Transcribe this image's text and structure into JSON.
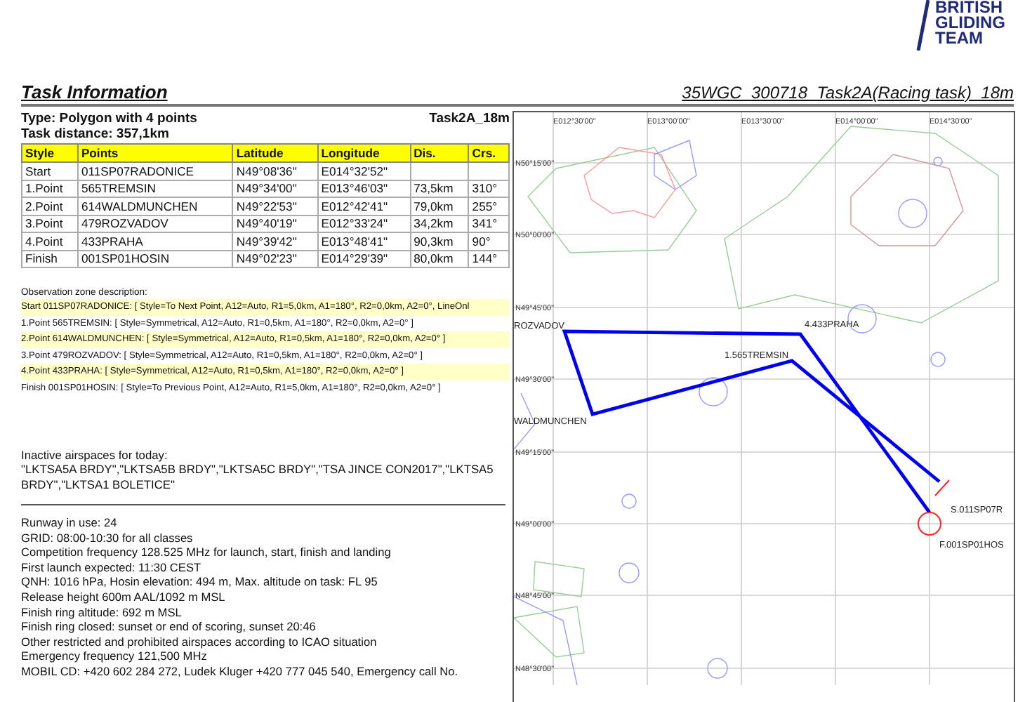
{
  "logo": {
    "lines": [
      "BRITISH",
      "GLIDING",
      "TEAM"
    ]
  },
  "header": {
    "title": "Task Information",
    "task_name": "35WGC_300718_Task2A(Racing task)_18m"
  },
  "task": {
    "type": "Type: Polygon with 4 points",
    "class_name": "Task2A_18m",
    "distance": "Task distance: 357,1km"
  },
  "table": {
    "columns": [
      "Style",
      "Points",
      "Latitude",
      "Longitude",
      "Dis.",
      "Crs."
    ],
    "rows": [
      [
        "Start",
        "011SP07RADONICE",
        "N49°08'36\"",
        "E014°32'52\"",
        "",
        ""
      ],
      [
        "1.Point",
        "565TREMSIN",
        "N49°34'00\"",
        "E013°46'03\"",
        "73,5km",
        "310°"
      ],
      [
        "2.Point",
        "614WALDMUNCHEN",
        "N49°22'53\"",
        "E012°42'41\"",
        "79,0km",
        "255°"
      ],
      [
        "3.Point",
        "479ROZVADOV",
        "N49°40'19\"",
        "E012°33'24\"",
        "34,2km",
        "341°"
      ],
      [
        "4.Point",
        "433PRAHA",
        "N49°39'42\"",
        "E013°48'41\"",
        "90,3km",
        "90°"
      ],
      [
        "Finish",
        "001SP01HOSIN",
        "N49°02'23\"",
        "E014°29'39\"",
        "80,0km",
        "144°"
      ]
    ]
  },
  "observation_zones": {
    "heading": "Observation zone description:",
    "items": [
      {
        "text": "Start 011SP07RADONICE: [ Style=To Next Point, A12=Auto, R1=5,0km, A1=180°, R2=0,0km, A2=0°, LineOnl",
        "highlighted": true
      },
      {
        "text": "1.Point 565TREMSIN: [ Style=Symmetrical, A12=Auto, R1=0,5km, A1=180°, R2=0,0km, A2=0° ]",
        "highlighted": false
      },
      {
        "text": "2.Point 614WALDMUNCHEN: [ Style=Symmetrical, A12=Auto, R1=0,5km, A1=180°, R2=0,0km, A2=0° ]",
        "highlighted": true
      },
      {
        "text": "3.Point 479ROZVADOV: [ Style=Symmetrical, A12=Auto, R1=0,5km, A1=180°, R2=0,0km, A2=0° ]",
        "highlighted": false
      },
      {
        "text": "4.Point 433PRAHA: [ Style=Symmetrical, A12=Auto, R1=0,5km, A1=180°, R2=0,0km, A2=0° ]",
        "highlighted": true
      },
      {
        "text": "Finish 001SP01HOSIN: [ Style=To Previous Point, A12=Auto, R1=5,0km, A1=180°, R2=0,0km, A2=0° ]",
        "highlighted": false
      }
    ]
  },
  "inactive_airspaces": {
    "heading": "Inactive airspaces for today:",
    "text": "\"LKTSA5A BRDY\",\"LKTSA5B BRDY\",\"LKTSA5C BRDY\",\"TSA JINCE CON2017\",\"LKTSA5 BRDY\",\"LKTSA1 BOLETICE\""
  },
  "notes": [
    "Runway in use: 24",
    "GRID: 08:00-10:30 for all classes",
    "Competition frequency 128.525 MHz for launch, start, finish and landing",
    "First launch expected: 11:30 CEST",
    "QNH: 1016 hPa, Hosin elevation: 494 m, Max. altitude on task: FL 95",
    "Release height 600m AAL/1092 m MSL",
    "Finish ring altitude: 692 m MSL",
    "Finish ring closed: sunset or end of scoring, sunset 20:46",
    "Other restricted and prohibited airspaces according to ICAO situation",
    "Emergency frequency 121,500 MHz",
    "MOBIL CD: +420 602 284 272, Ludek Kluger +420 777 045 540, Emergency call No."
  ],
  "map": {
    "longitude_labels": [
      "E012°30'00\"",
      "E013°00'00\"",
      "E013°30'00\"",
      "E014°00'00\"",
      "E014°30'00\""
    ],
    "latitude_labels": [
      "N50°15'00\"",
      "N50°00'00\"",
      "N49°45'00\"",
      "N49°30'00\"",
      "N49°15'00\"",
      "N49°00'00\"",
      "N48°45'00\"",
      "N48°30'00\""
    ],
    "waypoints": [
      {
        "label": "ROZVADOV",
        "kind": "turnpoint"
      },
      {
        "label": "4.433PRAHA",
        "kind": "turnpoint"
      },
      {
        "label": "1.565TREMSIN",
        "kind": "turnpoint"
      },
      {
        "label": "WALDMUNCHEN",
        "kind": "turnpoint"
      },
      {
        "label": "S.011SP07R",
        "kind": "start"
      },
      {
        "label": "F.001SP01HOS",
        "kind": "finish"
      }
    ]
  }
}
